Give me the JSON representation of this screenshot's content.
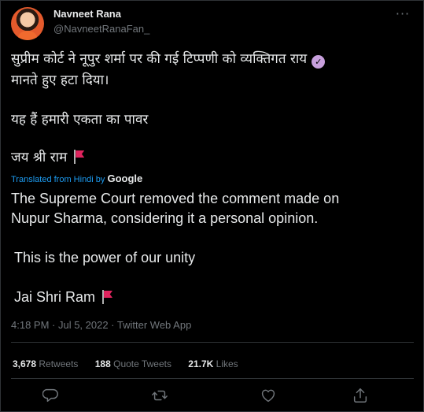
{
  "author": {
    "display_name": "Navneet Rana",
    "handle": "@NavneetRanaFan_"
  },
  "tweet": {
    "original_lines": [
      "सुप्रीम कोर्ट ने नूपुर शर्मा पर की गई टिप्पणी को व्यक्तिगत राय",
      "मानते हुए हटा दिया।",
      "यह हैं हमारी एकता का पावर",
      "जय श्री राम"
    ],
    "translation_label": "Translated from Hindi by",
    "translation_provider": "Google",
    "translated_lines": [
      "The Supreme Court removed the comment made on",
      "Nupur Sharma, considering it a personal opinion.",
      "This is the power of our unity",
      "Jai Shri Ram"
    ],
    "timestamp": "4:18 PM · Jul 5, 2022 · Twitter Web App"
  },
  "stats": {
    "retweets_count": "3,678",
    "retweets_label": "Retweets",
    "quotes_count": "188",
    "quotes_label": "Quote Tweets",
    "likes_count": "21.7K",
    "likes_label": "Likes"
  },
  "icons": {
    "verified": "verified-badge-icon",
    "flag": "red-flag-icon",
    "more": "more-options-icon",
    "reply": "reply-icon",
    "retweet": "retweet-icon",
    "like": "like-icon",
    "share": "share-icon"
  },
  "colors": {
    "background": "#000000",
    "text": "#e7e9ea",
    "secondary": "#71767b",
    "link": "#1d9bf0",
    "verified": "#c8a0dd",
    "flag": "#e0245e"
  }
}
